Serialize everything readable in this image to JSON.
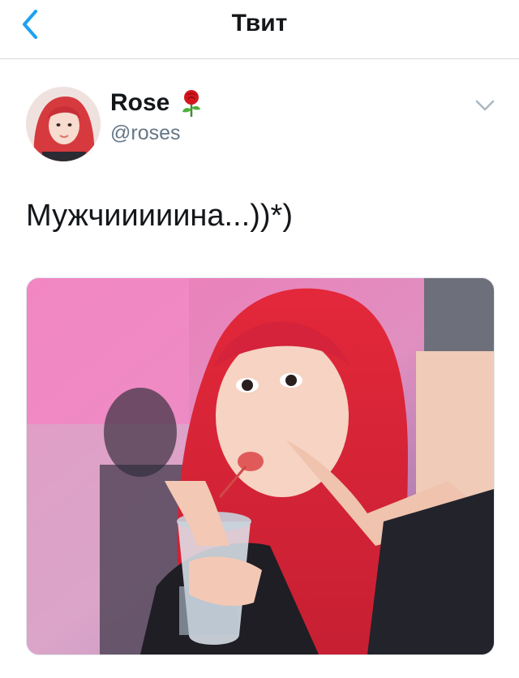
{
  "header": {
    "title": "Твит",
    "back_icon": "chevron-left-icon",
    "accent_color": "#1da1f2"
  },
  "tweet": {
    "author": {
      "display_name": "Rose",
      "name_emoji": "rose-emoji-icon",
      "username": "@roses"
    },
    "text": "Мужчииииина...))*)",
    "more_icon": "chevron-down-icon",
    "media": {
      "type": "photo",
      "description_icon": "photo-icon"
    }
  }
}
